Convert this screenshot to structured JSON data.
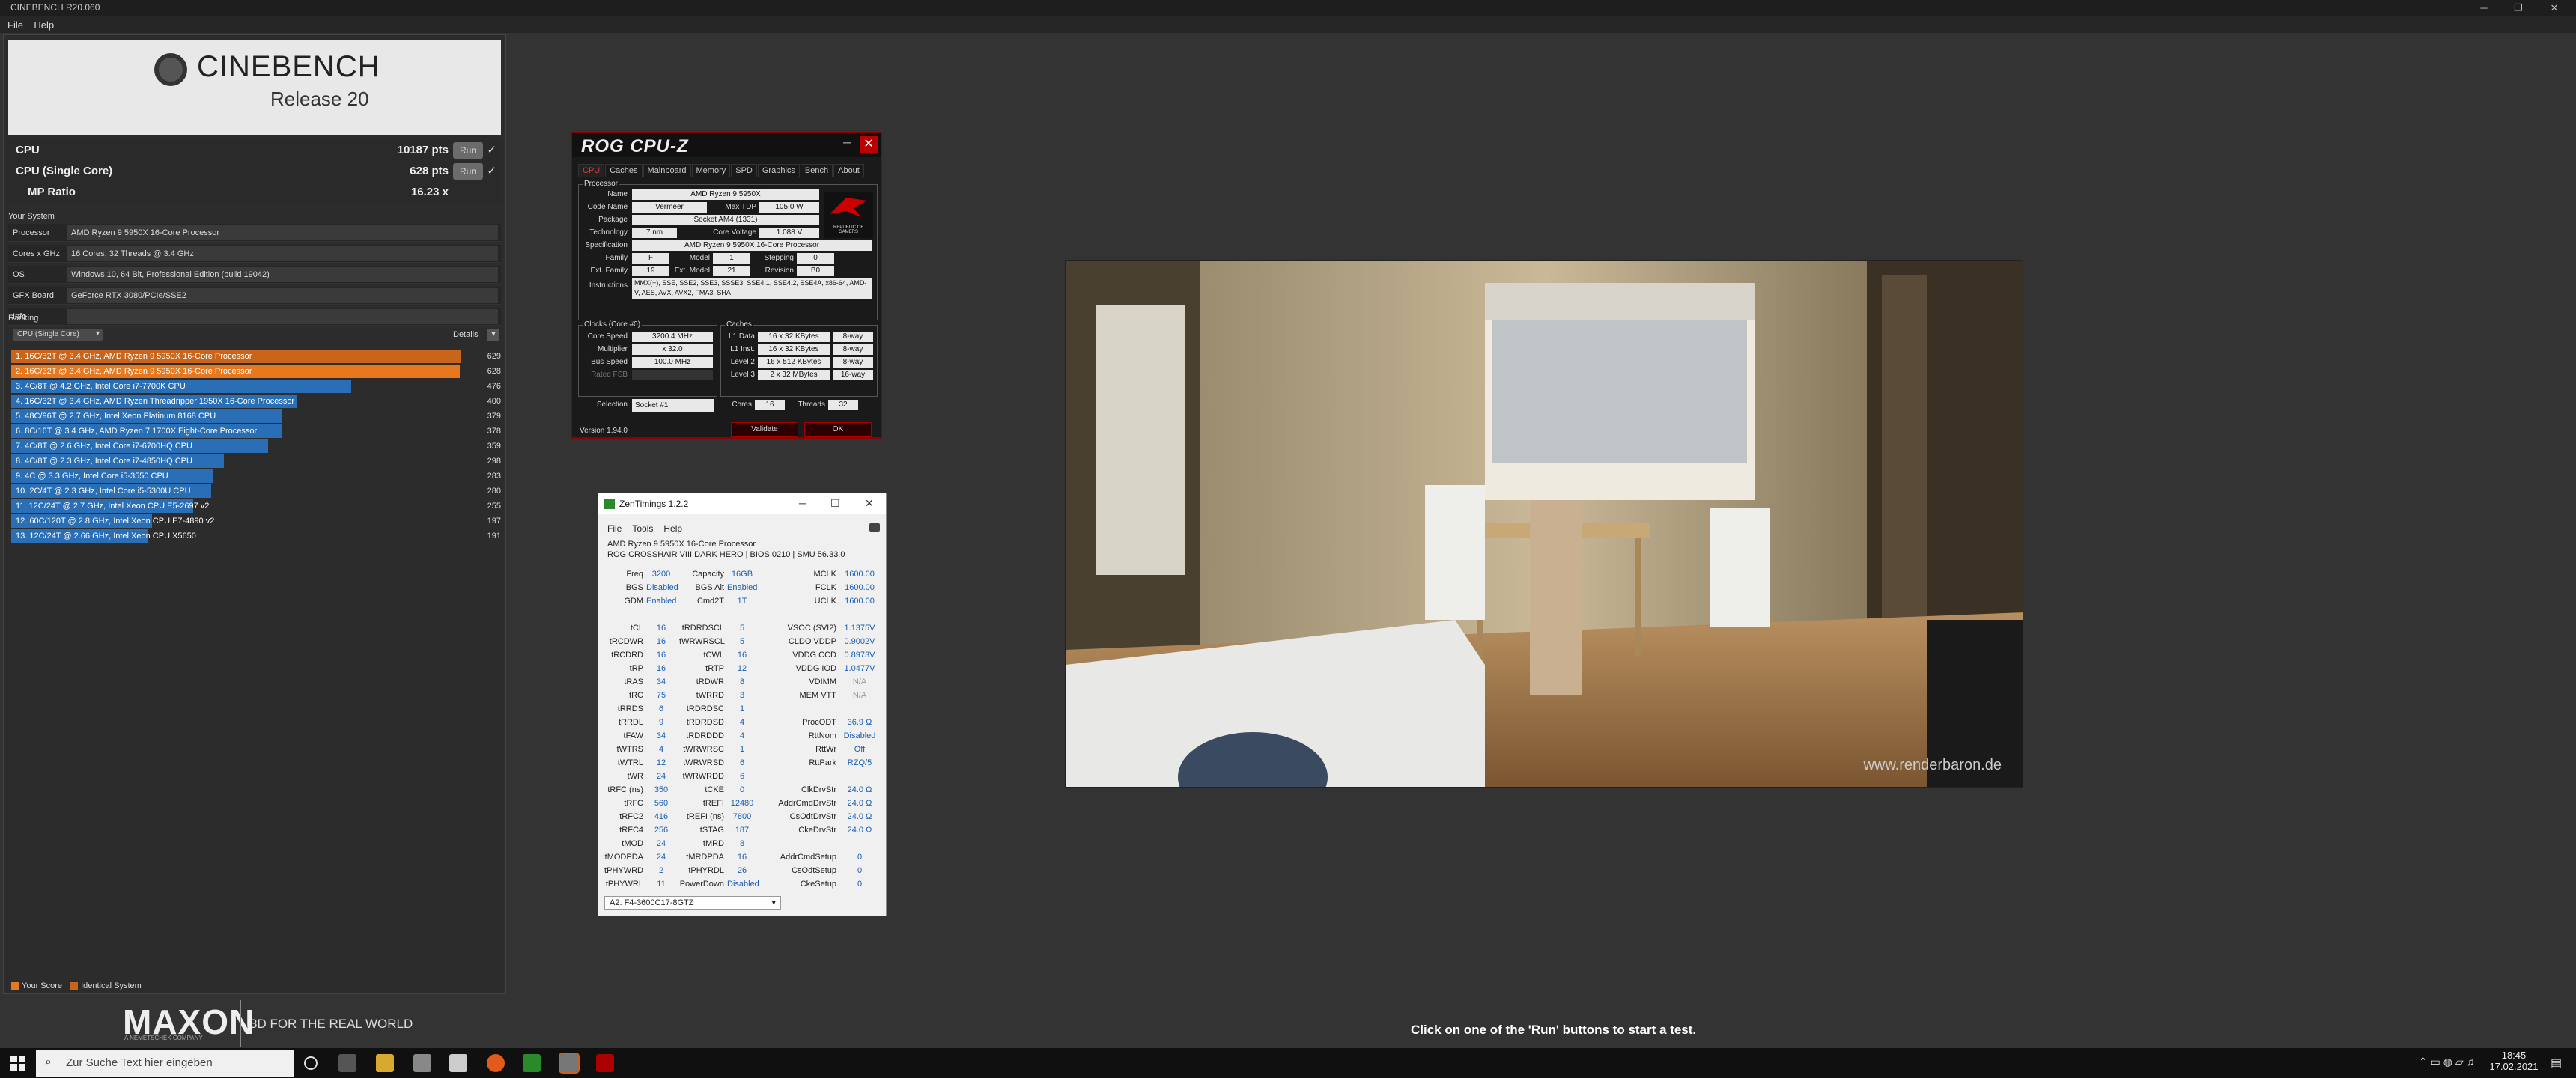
{
  "window": {
    "title": "CINEBENCH R20.060"
  },
  "menu": {
    "file": "File",
    "help": "Help"
  },
  "logo": {
    "name": "CINEBENCH",
    "release": "Release 20"
  },
  "scores": [
    {
      "label": "CPU",
      "value": "10187 pts",
      "run": "Run",
      "check": "✓"
    },
    {
      "label": "CPU (Single Core)",
      "value": "628 pts",
      "run": "Run",
      "check": "✓"
    },
    {
      "label": "MP Ratio",
      "value": "16.23 x"
    }
  ],
  "system": {
    "title": "Your System",
    "rows": [
      {
        "key": "Processor",
        "value": "AMD Ryzen 9 5950X 16-Core Processor"
      },
      {
        "key": "Cores x GHz",
        "value": "16 Cores, 32 Threads @ 3.4 GHz"
      },
      {
        "key": "OS",
        "value": "Windows 10, 64 Bit, Professional Edition (build 19042)"
      },
      {
        "key": "GFX Board",
        "value": "GeForce RTX 3080/PCIe/SSE2"
      },
      {
        "key": "Info",
        "value": ""
      }
    ]
  },
  "ranking": {
    "title": "Ranking",
    "dropdown": "CPU (Single Core)",
    "details": "Details",
    "items": [
      {
        "label": "1. 16C/32T @ 3.4 GHz, AMD Ryzen 9 5950X 16-Core Processor",
        "score": "629",
        "frac": 1.0,
        "color": "#c8651b"
      },
      {
        "label": "2. 16C/32T @ 3.4 GHz, AMD Ryzen 9 5950X 16-Core Processor",
        "score": "628",
        "frac": 0.998,
        "color": "#e8781e"
      },
      {
        "label": "3. 4C/8T @ 4.2 GHz, Intel Core i7-7700K CPU",
        "score": "476",
        "frac": 0.757,
        "color": "#2a6fb5"
      },
      {
        "label": "4. 16C/32T @ 3.4 GHz, AMD Ryzen Threadripper 1950X 16-Core Processor",
        "score": "400",
        "frac": 0.636,
        "color": "#2a6fb5"
      },
      {
        "label": "5. 48C/96T @ 2.7 GHz, Intel Xeon Platinum 8168 CPU",
        "score": "379",
        "frac": 0.603,
        "color": "#2a6fb5"
      },
      {
        "label": "6. 8C/16T @ 3.4 GHz, AMD Ryzen 7 1700X Eight-Core Processor",
        "score": "378",
        "frac": 0.601,
        "color": "#2a6fb5"
      },
      {
        "label": "7. 4C/8T @ 2.6 GHz, Intel Core i7-6700HQ CPU",
        "score": "359",
        "frac": 0.571,
        "color": "#2a6fb5"
      },
      {
        "label": "8. 4C/8T @ 2.3 GHz, Intel Core i7-4850HQ CPU",
        "score": "298",
        "frac": 0.474,
        "color": "#2a6fb5"
      },
      {
        "label": "9. 4C @ 3.3 GHz, Intel Core i5-3550 CPU",
        "score": "283",
        "frac": 0.45,
        "color": "#2a6fb5"
      },
      {
        "label": "10. 2C/4T @ 2.3 GHz, Intel Core i5-5300U CPU",
        "score": "280",
        "frac": 0.445,
        "color": "#2a6fb5"
      },
      {
        "label": "11. 12C/24T @ 2.7 GHz, Intel Xeon CPU E5-2697 v2",
        "score": "255",
        "frac": 0.405,
        "color": "#2a6fb5"
      },
      {
        "label": "12. 60C/120T @ 2.8 GHz, Intel Xeon CPU E7-4890 v2",
        "score": "197",
        "frac": 0.313,
        "color": "#2a6fb5"
      },
      {
        "label": "13. 12C/24T @ 2.66 GHz, Intel Xeon CPU X5650",
        "score": "191",
        "frac": 0.304,
        "color": "#2a6fb5"
      }
    ]
  },
  "legend": {
    "your_score": "Your Score",
    "identical": "Identical System",
    "your_color": "#e8781e",
    "identical_color": "#c8651b"
  },
  "maxon": {
    "logo": "MAXON",
    "sub": "A NEMETSCHEK COMPANY",
    "tagline": "3D FOR THE REAL WORLD"
  },
  "status": "Click on one of the 'Run' buttons to start a test.",
  "render": {
    "watermark": "www.renderbaron.de"
  },
  "cpuz": {
    "title": "ROG CPU-Z",
    "tabs": [
      "CPU",
      "Caches",
      "Mainboard",
      "Memory",
      "SPD",
      "Graphics",
      "Bench",
      "About"
    ],
    "processor_group": "Processor",
    "name": "AMD Ryzen 9 5950X",
    "code_name": "Vermeer",
    "max_tdp": "105.0 W",
    "package": "Socket AM4 (1331)",
    "technology": "7 nm",
    "core_voltage": "1.088 V",
    "specification": "AMD Ryzen 9 5950X 16-Core Processor",
    "family": "F",
    "model": "1",
    "stepping": "0",
    "ext_family": "19",
    "ext_model": "21",
    "revision": "B0",
    "instructions": "MMX(+), SSE, SSE2, SSE3, SSSE3, SSE4.1, SSE4.2, SSE4A, x86-64, AMD-V, AES, AVX, AVX2, FMA3, SHA",
    "clocks_group": "Clocks (Core #0)",
    "core_speed": "3200.4 MHz",
    "multiplier": "x 32.0",
    "bus_speed": "100.0 MHz",
    "rated_fsb": "",
    "caches_group": "Caches",
    "l1d": "16 x 32 KBytes",
    "l1d_way": "8-way",
    "l1i": "16 x 32 KBytes",
    "l1i_way": "8-way",
    "l2": "16 x 512 KBytes",
    "l2_way": "8-way",
    "l3": "2 x 32 MBytes",
    "l3_way": "16-way",
    "selection_label": "Selection",
    "selection": "Socket #1",
    "cores_label": "Cores",
    "cores": "16",
    "threads_label": "Threads",
    "threads": "32",
    "version": "Version 1.94.0",
    "validate": "Validate",
    "ok": "OK",
    "labels": {
      "name": "Name",
      "code_name": "Code Name",
      "max_tdp": "Max TDP",
      "package": "Package",
      "technology": "Technology",
      "core_voltage": "Core Voltage",
      "specification": "Specification",
      "family": "Family",
      "model": "Model",
      "stepping": "Stepping",
      "ext_family": "Ext. Family",
      "ext_model": "Ext. Model",
      "revision": "Revision",
      "instructions": "Instructions",
      "core_speed": "Core Speed",
      "multiplier": "Multiplier",
      "bus_speed": "Bus Speed",
      "rated_fsb": "Rated FSB",
      "l1d": "L1 Data",
      "l1i": "L1 Inst.",
      "l2": "Level 2",
      "l3": "Level 3"
    },
    "brand": "REPUBLIC OF GAMERS"
  },
  "zen": {
    "title": "ZenTimings 1.2.2",
    "menu": [
      "File",
      "Tools",
      "Help"
    ],
    "cpu": "AMD Ryzen 9 5950X 16-Core Processor",
    "board": "ROG CROSSHAIR VIII DARK HERO | BIOS 0210 | SMU 56.33.0",
    "col1": [
      [
        "Freq",
        "3200"
      ],
      [
        "BGS",
        "Disabled"
      ],
      [
        "GDM",
        "Enabled"
      ],
      [
        "",
        ""
      ],
      [
        "tCL",
        "16"
      ],
      [
        "tRCDWR",
        "16"
      ],
      [
        "tRCDRD",
        "16"
      ],
      [
        "tRP",
        "16"
      ],
      [
        "tRAS",
        "34"
      ],
      [
        "tRC",
        "75"
      ],
      [
        "tRRDS",
        "6"
      ],
      [
        "tRRDL",
        "9"
      ],
      [
        "tFAW",
        "34"
      ],
      [
        "tWTRS",
        "4"
      ],
      [
        "tWTRL",
        "12"
      ],
      [
        "tWR",
        "24"
      ],
      [
        "tRFC (ns)",
        "350"
      ],
      [
        "tRFC",
        "560"
      ],
      [
        "tRFC2",
        "416"
      ],
      [
        "tRFC4",
        "256"
      ],
      [
        "tMOD",
        "24"
      ],
      [
        "tMODPDA",
        "24"
      ],
      [
        "tPHYWRD",
        "2"
      ],
      [
        "tPHYWRL",
        "11"
      ]
    ],
    "col2": [
      [
        "Capacity",
        "16GB"
      ],
      [
        "BGS Alt",
        "Enabled"
      ],
      [
        "Cmd2T",
        "1T"
      ],
      [
        "",
        ""
      ],
      [
        "tRDRDSCL",
        "5"
      ],
      [
        "tWRWRSCL",
        "5"
      ],
      [
        "tCWL",
        "16"
      ],
      [
        "tRTP",
        "12"
      ],
      [
        "tRDWR",
        "8"
      ],
      [
        "tWRRD",
        "3"
      ],
      [
        "tRDRDSC",
        "1"
      ],
      [
        "tRDRDSD",
        "4"
      ],
      [
        "tRDRDDD",
        "4"
      ],
      [
        "tWRWRSC",
        "1"
      ],
      [
        "tWRWRSD",
        "6"
      ],
      [
        "tWRWRDD",
        "6"
      ],
      [
        "tCKE",
        "0"
      ],
      [
        "tREFI",
        "12480"
      ],
      [
        "tREFI (ns)",
        "7800"
      ],
      [
        "tSTAG",
        "187"
      ],
      [
        "tMRD",
        "8"
      ],
      [
        "tMRDPDA",
        "16"
      ],
      [
        "tPHYRDL",
        "26"
      ],
      [
        "PowerDown",
        "Disabled"
      ]
    ],
    "col3": [
      [
        "MCLK",
        "1600.00"
      ],
      [
        "FCLK",
        "1600.00"
      ],
      [
        "UCLK",
        "1600.00"
      ],
      [
        "",
        ""
      ],
      [
        "VSOC (SVI2)",
        "1.1375V"
      ],
      [
        "CLDO VDDP",
        "0.9002V"
      ],
      [
        "VDDG CCD",
        "0.8973V"
      ],
      [
        "VDDG IOD",
        "1.0477V"
      ],
      [
        "VDIMM",
        "N/A"
      ],
      [
        "MEM VTT",
        "N/A"
      ],
      [
        "",
        ""
      ],
      [
        "ProcODT",
        "36.9 Ω"
      ],
      [
        "RttNom",
        "Disabled"
      ],
      [
        "RttWr",
        "Off"
      ],
      [
        "RttPark",
        "RZQ/5"
      ],
      [
        "",
        ""
      ],
      [
        "ClkDrvStr",
        "24.0 Ω"
      ],
      [
        "AddrCmdDrvStr",
        "24.0 Ω"
      ],
      [
        "CsOdtDrvStr",
        "24.0 Ω"
      ],
      [
        "CkeDrvStr",
        "24.0 Ω"
      ],
      [
        "",
        ""
      ],
      [
        "AddrCmdSetup",
        "0"
      ],
      [
        "CsOdtSetup",
        "0"
      ],
      [
        "CkeSetup",
        "0"
      ]
    ],
    "dimm": "A2: F4-3600C17-8GTZ"
  },
  "taskbar": {
    "search_placeholder": "Zur Suche Text hier eingeben",
    "time": "18:45",
    "date": "17.02.2021"
  }
}
